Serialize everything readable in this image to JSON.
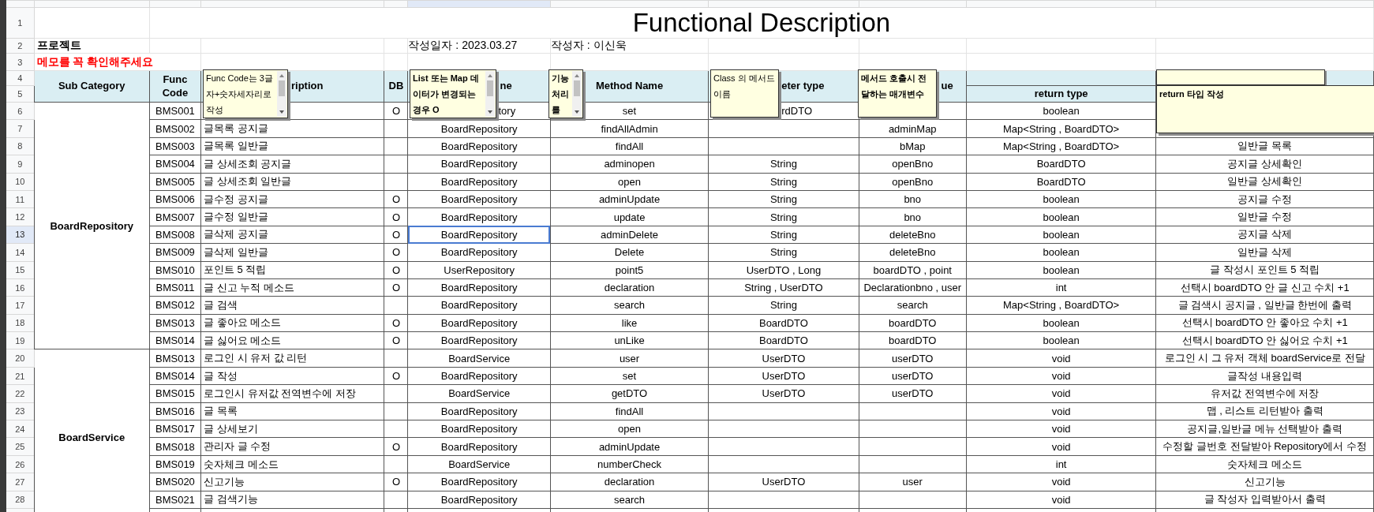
{
  "title": "Functional Description",
  "project_label": "프로젝트",
  "date": "작성일자 : 2023.03.27",
  "author": "작성자 :  이신욱",
  "memo_notice": "메모를 꼭 확인해주세요",
  "row_headers": [
    {
      "label": "1",
      "selected": false
    },
    {
      "label": "2",
      "selected": false
    },
    {
      "label": "3",
      "selected": false
    },
    {
      "label": "4",
      "selected": false
    },
    {
      "label": "5",
      "selected": false
    },
    {
      "label": "6",
      "selected": false
    },
    {
      "label": "7",
      "selected": false
    },
    {
      "label": "8",
      "selected": false
    },
    {
      "label": "9",
      "selected": false
    },
    {
      "label": "10",
      "selected": false
    },
    {
      "label": "11",
      "selected": false
    },
    {
      "label": "12",
      "selected": false
    },
    {
      "label": "13",
      "selected": true
    },
    {
      "label": "14",
      "selected": false
    },
    {
      "label": "15",
      "selected": false
    },
    {
      "label": "16",
      "selected": false
    },
    {
      "label": "17",
      "selected": false
    },
    {
      "label": "18",
      "selected": false
    },
    {
      "label": "19",
      "selected": false
    },
    {
      "label": "20",
      "selected": false
    },
    {
      "label": "21",
      "selected": false
    },
    {
      "label": "22",
      "selected": false
    },
    {
      "label": "23",
      "selected": false
    },
    {
      "label": "24",
      "selected": false
    },
    {
      "label": "25",
      "selected": false
    },
    {
      "label": "26",
      "selected": false
    },
    {
      "label": "27",
      "selected": false
    },
    {
      "label": "28",
      "selected": false
    }
  ],
  "columns": [
    {
      "label": "Sub Category",
      "selected": false
    },
    {
      "label": "Func Code",
      "selected": false
    },
    {
      "label": "ription",
      "selected": false
    },
    {
      "label": "DB",
      "selected": false
    },
    {
      "label": "ne",
      "selected": true
    },
    {
      "label": "Method Name",
      "selected": false
    },
    {
      "label": "eter type",
      "selected": false
    },
    {
      "label": "ue",
      "selected": false
    },
    {
      "label": "return type",
      "selected": false
    },
    {
      "selected": false
    }
  ],
  "sections": [
    {
      "sub_category": "BoardRepository",
      "rows": [
        {
          "func_code": "BMS001",
          "db": "O",
          "class_name": "tory",
          "method_name": "set",
          "parameter_type": "rdDTO",
          "return_type": "boolean"
        },
        {
          "func_code": "BMS002",
          "description": "글목록 공지글",
          "class_name": "BoardRepository",
          "method_name": "findAllAdmin",
          "parameter_value": "adminMap",
          "return_type": "Map<String , BoardDTO>"
        },
        {
          "func_code": "BMS003",
          "description": "글목록 일반글",
          "class_name": "BoardRepository",
          "method_name": "findAll",
          "parameter_value": "bMap",
          "return_type": "Map<String , BoardDTO>",
          "note": "일반글 목록"
        },
        {
          "func_code": "BMS004",
          "description": "글 상세조회 공지글",
          "class_name": "BoardRepository",
          "method_name": "adminopen",
          "parameter_type": "String",
          "parameter_value": "openBno",
          "return_type": "BoardDTO",
          "note": "공지글 상세확인"
        },
        {
          "func_code": "BMS005",
          "description": "글 상세조회 일반글",
          "class_name": "BoardRepository",
          "method_name": "open",
          "parameter_type": "String",
          "parameter_value": "openBno",
          "return_type": "BoardDTO",
          "note": "일반글 상세확인"
        },
        {
          "func_code": "BMS006",
          "description": "글수정 공지글",
          "db": "O",
          "class_name": "BoardRepository",
          "method_name": "adminUpdate",
          "parameter_type": "String",
          "parameter_value": "bno",
          "return_type": "boolean",
          "note": "공지글 수정"
        },
        {
          "func_code": "BMS007",
          "description": "글수정 일반글",
          "db": "O",
          "class_name": "BoardRepository",
          "method_name": "update",
          "parameter_type": "String",
          "parameter_value": "bno",
          "return_type": "boolean",
          "note": "일반글 수정"
        },
        {
          "func_code": "BMS008",
          "description": "글삭제 공지글",
          "db": "O",
          "class_name": "BoardRepository",
          "method_name": "adminDelete",
          "parameter_type": "String",
          "parameter_value": "deleteBno",
          "return_type": "boolean",
          "note": "공지글 삭제"
        },
        {
          "func_code": "BMS009",
          "description": "글삭제 일반글",
          "db": "O",
          "class_name": "BoardRepository",
          "method_name": "Delete",
          "parameter_type": "String",
          "parameter_value": "deleteBno",
          "return_type": "boolean",
          "note": "일반글 삭제"
        },
        {
          "func_code": "BMS010",
          "description": "포인트 5 적립",
          "db": "O",
          "class_name": "UserRepository",
          "method_name": "point5",
          "parameter_type": "UserDTO , Long",
          "parameter_value": "boardDTO , point",
          "return_type": "boolean",
          "note": "글 작성시 포인트 5 적립"
        },
        {
          "func_code": "BMS011",
          "description": "글 신고 누적 메소드",
          "db": "O",
          "class_name": "BoardRepository",
          "method_name": "declaration",
          "parameter_type": "String , UserDTO",
          "parameter_value": "Declarationbno , user",
          "return_type": "int",
          "note": "선택시 boardDTO 안 글 신고 수치 +1"
        },
        {
          "func_code": "BMS012",
          "description": "글 검색",
          "class_name": "BoardRepository",
          "method_name": "search",
          "parameter_type": "String",
          "parameter_value": "search",
          "return_type": "Map<String , BoardDTO>",
          "note": "글 검색시 공지글 , 일반글 한번에 출력"
        },
        {
          "func_code": "BMS013",
          "description": "글 좋아요 메소드",
          "db": "O",
          "class_name": "BoardRepository",
          "method_name": "like",
          "parameter_type": "BoardDTO",
          "parameter_value": "boardDTO",
          "return_type": "boolean",
          "note": "선택시 boardDTO 안 좋아요 수치 +1"
        },
        {
          "func_code": "BMS014",
          "description": "글 싫어요 메소드",
          "db": "O",
          "class_name": "BoardRepository",
          "method_name": "unLike",
          "parameter_type": "BoardDTO",
          "parameter_value": "boardDTO",
          "return_type": "boolean",
          "note": "선택시 boardDTO 안 싫어요 수치 +1"
        }
      ]
    },
    {
      "sub_category": "BoardService",
      "rows": [
        {
          "func_code": "BMS013",
          "description": "로그인 시 유저 값 리턴",
          "class_name": "BoardService",
          "method_name": "user",
          "parameter_type": "UserDTO",
          "parameter_value": "userDTO",
          "return_type": "void",
          "note": "로그인 시 그 유저 객체 boardService로 전달"
        },
        {
          "func_code": "BMS014",
          "description": "글 작성",
          "db": "O",
          "class_name": "BoardRepository",
          "method_name": "set",
          "parameter_type": "UserDTO",
          "parameter_value": "userDTO",
          "return_type": "void",
          "note": "글작성 내용입력"
        },
        {
          "func_code": "BMS015",
          "description": "로그인시 유저값 전역변수에 저장",
          "class_name": "BoardService",
          "method_name": "getDTO",
          "parameter_type": "UserDTO",
          "parameter_value": "userDTO",
          "return_type": "void",
          "note": "유저값 전역변수에 저장"
        },
        {
          "func_code": "BMS016",
          "description": "글 목록",
          "class_name": "BoardRepository",
          "method_name": "findAll",
          "return_type": "void",
          "note": "맵 , 리스트 리턴받아 출력"
        },
        {
          "func_code": "BMS017",
          "description": "글 상세보기",
          "class_name": "BoardRepository",
          "method_name": "open",
          "return_type": "void",
          "note": "공지글,일반글 메뉴 선택받아 출력"
        },
        {
          "func_code": "BMS018",
          "description": "관리자 글 수정",
          "db": "O",
          "class_name": "BoardRepository",
          "method_name": "adminUpdate",
          "return_type": "void",
          "note": "수정할 글번호 전달받아 Repository에서 수정"
        },
        {
          "func_code": "BMS019",
          "description": "숫자체크 메소드",
          "class_name": "BoardService",
          "method_name": "numberCheck",
          "return_type": "int",
          "note": "숫자체크 메소드"
        },
        {
          "func_code": "BMS020",
          "description": "신고기능",
          "db": "O",
          "class_name": "BoardRepository",
          "method_name": "declaration",
          "parameter_type": "UserDTO",
          "parameter_value": "user",
          "return_type": "void",
          "note": "신고기능"
        },
        {
          "func_code": "BMS021",
          "description": "글 검색기능",
          "class_name": "BoardRepository",
          "method_name": "search",
          "return_type": "void",
          "note": "글 작성자 입력받아서 출력"
        }
      ]
    }
  ],
  "notes": [
    {
      "kind": "scroll",
      "text": "Func Code는 3글자+숫자세자리로 작성",
      "bold": false
    },
    {
      "kind": "scroll",
      "text": "List 또는 Map 데이터가 변경되는 경우 O",
      "bold": true
    },
    {
      "kind": "scroll",
      "text": "기능처리를",
      "bold": true
    },
    {
      "kind": "plain",
      "text": "Class 의 메서드 이름",
      "bold": false
    },
    {
      "kind": "plain",
      "text": "메서드 호출시 전달하는 매개변수",
      "bold": true
    },
    {
      "kind": "blank"
    },
    {
      "kind": "plain",
      "text": "return 타입 작성",
      "bold": true
    }
  ]
}
